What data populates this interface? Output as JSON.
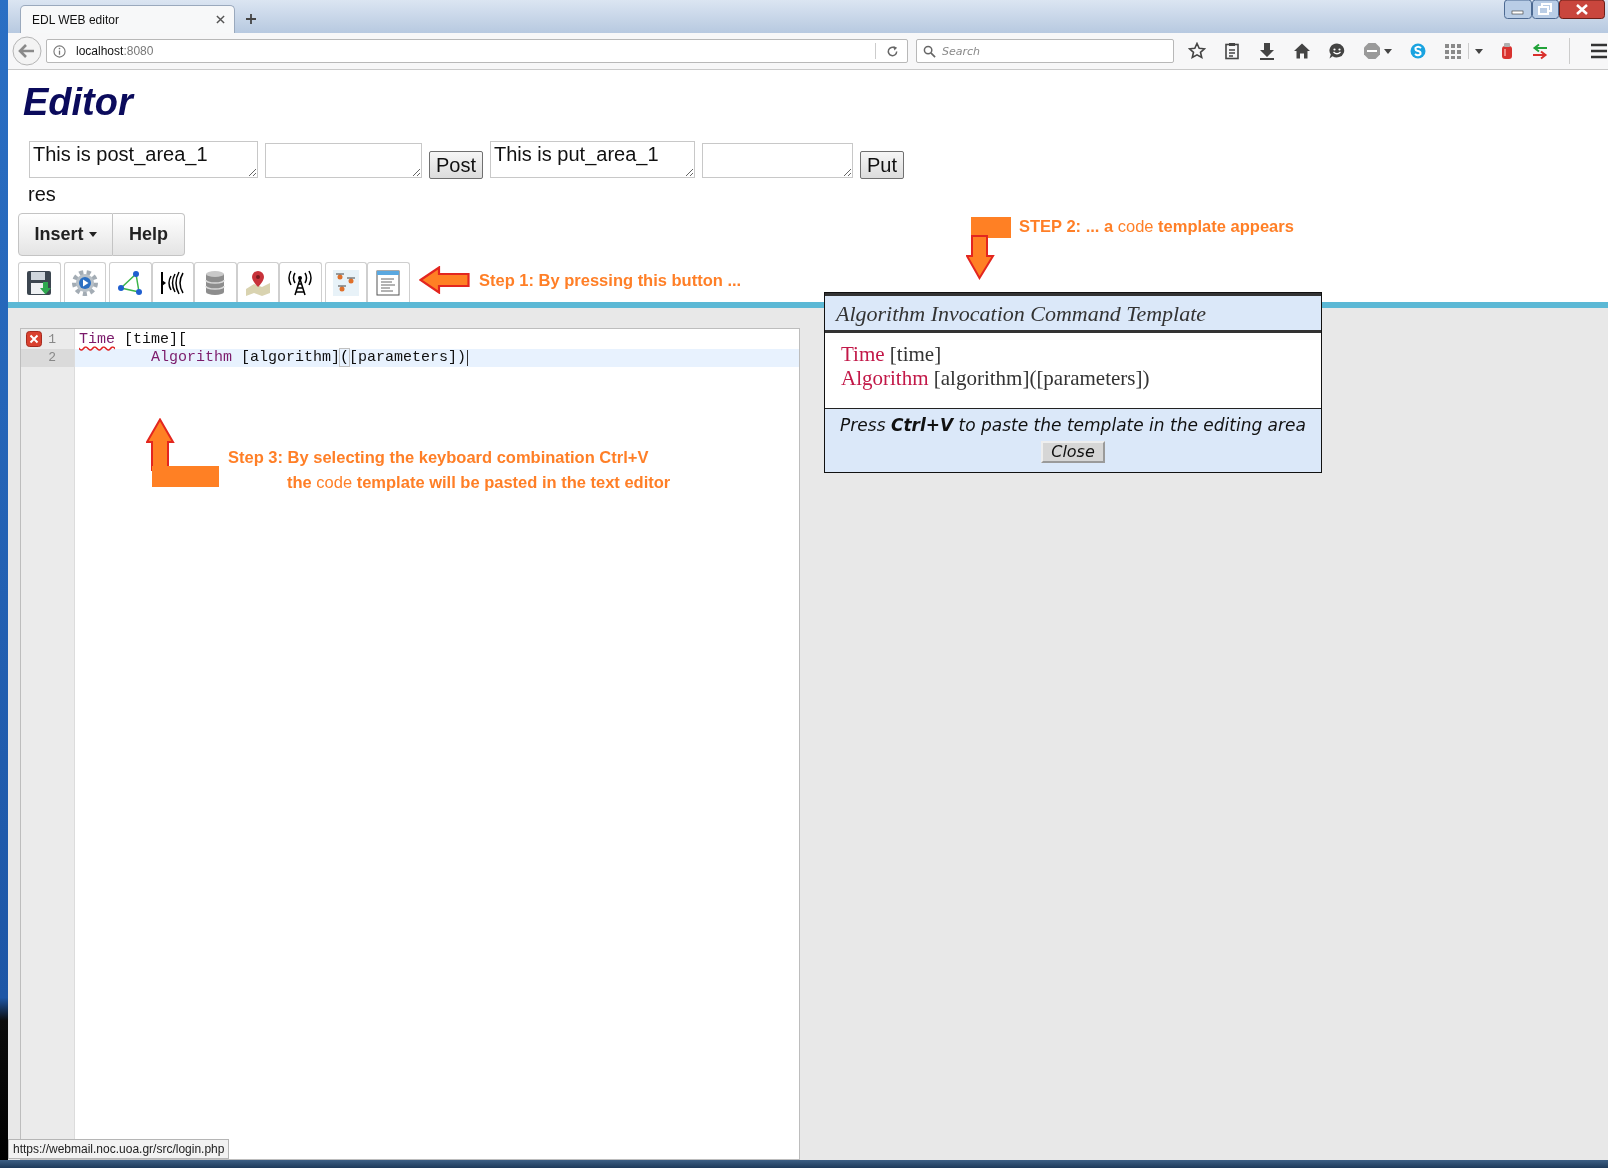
{
  "browser": {
    "tabs": [
      {
        "title": "EDL WEB editor",
        "selected": true
      }
    ],
    "address": {
      "host": "localhost",
      "port": ":8080"
    },
    "search": {
      "placeholder": "Search"
    }
  },
  "page": {
    "title": "Editor",
    "forms": [
      {
        "value": "This is post_area_1",
        "button": "Post"
      },
      {
        "value": "This is put_area_1",
        "button": "Put"
      }
    ],
    "result": "res",
    "menu": [
      {
        "label": "Insert",
        "kind": "dropdown"
      },
      {
        "label": "Help",
        "kind": "button"
      }
    ]
  },
  "editor": {
    "lines": [
      {
        "number": "1",
        "error": true,
        "active": false,
        "cursor": false,
        "tokens": [
          {
            "kind": "keyword",
            "text": "Time",
            "misspelled": true
          },
          {
            "kind": "plain",
            "text": " [time][",
            "misspelled": false
          }
        ],
        "children": [
          {
            "number": "2",
            "error": false,
            "active": true,
            "cursor": true,
            "tokens": [
              {
                "kind": "keyword",
                "text": "Algorithm",
                "misspelled": false
              },
              {
                "kind": "plain",
                "text": " [algorithm]",
                "misspelled": false
              },
              {
                "kind": "matched-bracket",
                "text": "(",
                "misspelled": false
              },
              {
                "kind": "plain",
                "text": "[parameters])",
                "misspelled": false
              }
            ]
          }
        ]
      }
    ]
  },
  "dialog": {
    "title": "Algorithm Invocation Command Template",
    "lines": [
      {
        "keyword": "Time",
        "argument": "[time]"
      },
      {
        "keyword": "Algorithm",
        "argument": "[algorithm]([parameters])"
      }
    ],
    "hint": "Press **Ctrl+V** to paste the template in the editing area",
    "button": "Close"
  },
  "annotations": [
    {
      "kind": "left-arrow",
      "lines": [
        {
          "text": "Step 1: By pressing this button ...",
          "bold": true
        }
      ]
    },
    {
      "kind": "down-elbow",
      "lines": [
        {
          "text": "**STEP 2: ... a** code **template appears**",
          "bold": false
        }
      ]
    },
    {
      "kind": "up-elbow",
      "lines": [
        {
          "text": "Step 3: By selecting the keyboard combination Ctrl+V",
          "bold": true
        },
        {
          "text": "**the** code **template will be pasted in the text editor**",
          "bold": false
        }
      ]
    }
  ],
  "status_bar": {
    "url": "https://webmail.noc.uoa.gr/src/login.php"
  }
}
